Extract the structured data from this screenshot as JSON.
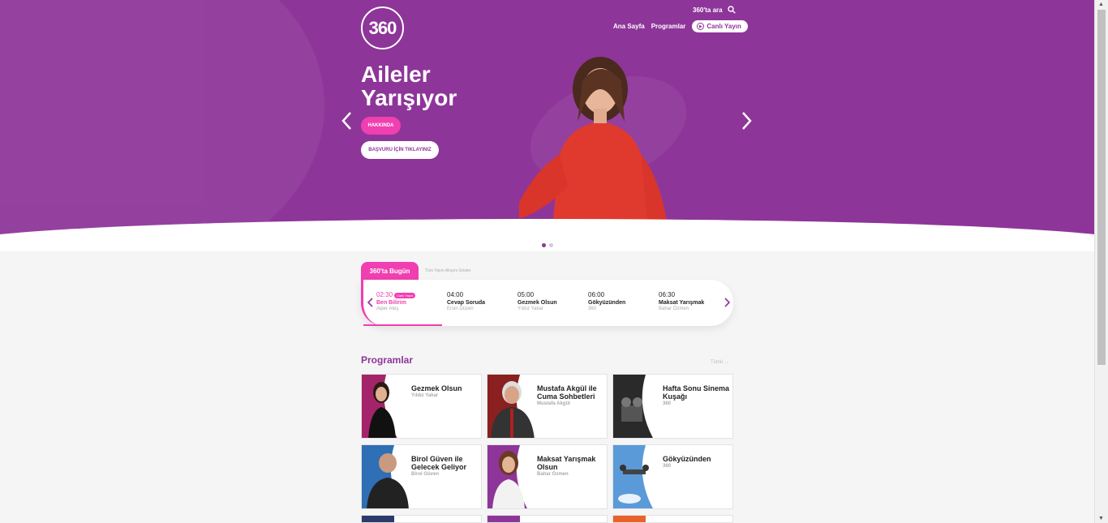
{
  "header": {
    "logo_text": "360",
    "search_label": "360'ta ara",
    "nav": [
      "Ana Sayfa",
      "Programlar"
    ],
    "live_label": "Canlı Yayın"
  },
  "hero": {
    "title_line1": "Aileler",
    "title_line2": "Yarışıyor",
    "about_button": "HAKKINDA",
    "apply_button": "BAŞVURU İÇİN TIKLAYINIZ",
    "slides_total": 2,
    "slide_active": 1
  },
  "schedule": {
    "tab_label": "360'ta Bugün",
    "all_link": "Tüm Yayın Akışını Göster",
    "live_tag": "Canlı Yayın",
    "items": [
      {
        "time": "02:30",
        "title": "Ben Bilirim",
        "host": "Alper Ateş"
      },
      {
        "time": "04:00",
        "title": "Cevap Soruda",
        "host": "Ersin Düzen"
      },
      {
        "time": "05:00",
        "title": "Gezmek Olsun",
        "host": "Yıldız Yakar"
      },
      {
        "time": "06:00",
        "title": "Gökyüzünden",
        "host": "360"
      },
      {
        "time": "06:30",
        "title": "Maksat Yarışmak",
        "host": "Bahar Özmen"
      }
    ]
  },
  "programs": {
    "heading": "Programlar",
    "all_link": "Tümü →",
    "cards": [
      {
        "title": "Gezmek Olsun",
        "host": "Yıldız Yakar"
      },
      {
        "title": "Mustafa Akgül ile Cuma Sohbetleri",
        "host": "Mustafa Akgül"
      },
      {
        "title": "Hafta Sonu Sinema Kuşağı",
        "host": "360"
      },
      {
        "title": "Birol Güven ile Gelecek Geliyor",
        "host": "Birol Güven"
      },
      {
        "title": "Maksat Yarışmak Olsun",
        "host": "Bahar Özmen"
      },
      {
        "title": "Gökyüzünden",
        "host": "360"
      }
    ]
  },
  "colors": {
    "brand_purple": "#8e3599",
    "accent_pink": "#f03fb0"
  }
}
